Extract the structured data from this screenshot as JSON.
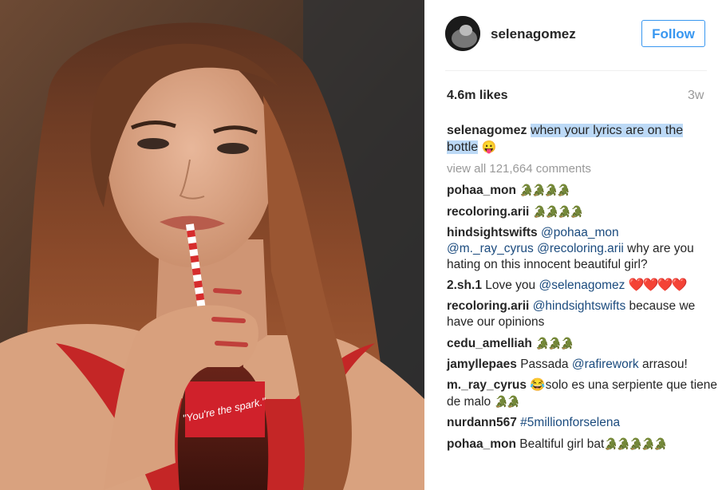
{
  "post": {
    "username": "selenagomez",
    "follow_label": "Follow",
    "likes": "4.6m likes",
    "time": "3w",
    "caption_user": "selenagomez",
    "caption_text": "when your lyrics are on the bottle",
    "view_all": "view all 121,664 comments"
  },
  "bottle_label": "\"You're the spark.\"",
  "comments": [
    {
      "user": "pohaa_mon",
      "text": "",
      "emoji": "🐊🐊🐊🐊"
    },
    {
      "user": "recoloring.arii",
      "text": "",
      "emoji": "🐊🐊🐊🐊"
    },
    {
      "user": "hindsightswifts",
      "mention1": "@pohaa_mon",
      "mention2": "@m._ray_cyrus",
      "mention3": "@recoloring.arii",
      "text": "why are you hating on this innocent beautiful girl?"
    },
    {
      "user": "2.sh.1",
      "text": "Love you",
      "mention": "@selenagomez",
      "emoji": "❤️❤️❤️❤️"
    },
    {
      "user": "recoloring.arii",
      "mention": "@hindsightswifts",
      "text": "because we have our opinions"
    },
    {
      "user": "cedu_amelliah",
      "text": "",
      "emoji": "🐊🐊🐊"
    },
    {
      "user": "jamyllepaes",
      "text": "Passada",
      "mention": "@rafirework",
      "text2": "arrasou!"
    },
    {
      "user": "m._ray_cyrus",
      "emoji_pre": "😂",
      "text": "solo es una serpiente que tiene de malo",
      "emoji": "🐊🐊"
    },
    {
      "user": "nurdann567",
      "mention": "#5millionforselena"
    },
    {
      "user": "pohaa_mon",
      "text": "Bealtiful girl bat",
      "emoji": "🐊🐊🐊🐊🐊"
    }
  ]
}
